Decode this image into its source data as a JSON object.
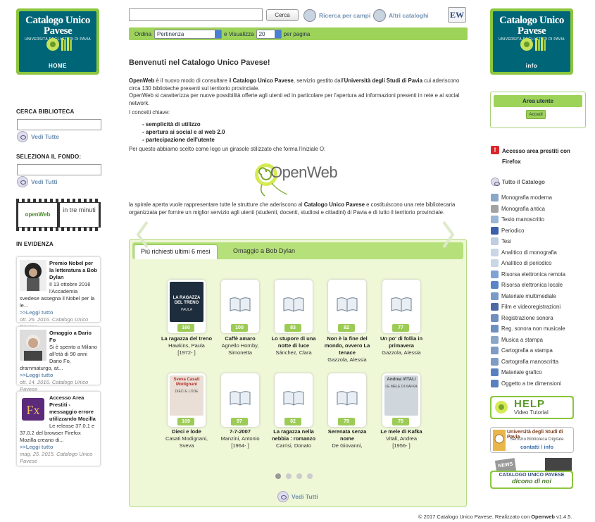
{
  "logos": {
    "left": {
      "title": "Catalogo Unico Pavese",
      "subtitle": "UNIVERSITÀ DEGLI STUDI DI PAVIA",
      "label": "HOME"
    },
    "right": {
      "title": "Catalogo Unico Pavese",
      "subtitle": "UNIVERSITÀ DEGLI STUDI DI PAVIA",
      "label": "info"
    }
  },
  "header": {
    "search_value": "",
    "search_button": "Cerca",
    "advanced_search": "Ricerca per campi",
    "other_catalogs": "Altri cataloghi",
    "ew_badge": "EW",
    "order_label": "Ordina",
    "order_value": "Pertinenza",
    "view_label": "e Visualizza",
    "view_value": "20",
    "per_page": "per pagina"
  },
  "left": {
    "cerca_biblioteca": "CERCA BIBLIOTECA",
    "vedi_tutte": "Vedi Tutte",
    "seleziona_fondo": "SELEZIONA IL FONDO:",
    "vedi_tutti": "Vedi Tutti",
    "video": {
      "brand": "openWeb",
      "caption": "in tre minuti"
    },
    "in_evidenza": "IN EVIDENZA",
    "news": [
      {
        "title": "Premio Nobel per la letteratura a Bob Dylan",
        "body": "Il 13 ottobre 2016 l'Accademia svedese assegna il Nobel per la le...",
        "more": ">>Leggi tutto",
        "date": "ott. 26. 2016.",
        "source": "Catalogo Unico Pavese"
      },
      {
        "title": "Omaggio a Dario Fo",
        "body": "Si è spento a Milano all'età di 90 anni Dario Fo, drammaturgo, at...",
        "more": ">>Leggi tutto",
        "date": "ott. 14. 2016.",
        "source": "Catalogo Unico Pavese"
      },
      {
        "title": "Accesso Area Prestiti - messaggio errore utilizzando Mozilla",
        "body": "Le release 37.0.1 e 37.0.2 del browser Firefox Mozilla creano di...",
        "more": ">>Leggi tutto",
        "date": "mag. 25. 2015.",
        "source": "Catalogo Unico Pavese"
      }
    ]
  },
  "main": {
    "welcome": "Benvenuti nel Catalogo Unico Pavese!",
    "intro_1": "OpenWeb",
    "intro_2": " è il nuovo modo di consultare  il ",
    "intro_3": "Catalogo Unico Pavese",
    "intro_4": ", servizio gestito dall'",
    "intro_5": "Università degli Studi di Pavia",
    "intro_6": " cui aderiscono circa 130 biblioteche presenti sul territorio provinciale.",
    "intro_7": "OpenWeb si caratterizza per nuove possibilità offerte agli utenti ed in particolare per l'apertura ad informazioni presenti in rete e ai social network.",
    "concepts": "I concetti chiave:",
    "keys": [
      "- semplicità di utilizzo",
      "- apertura ai social e al web 2.0",
      "- partecipazione dell'utente"
    ],
    "logo_text": "Per questo abbiamo scelto come logo un girasole stilizzato che forma l'iniziale O:",
    "openweb_logo": "OpenWeb",
    "spiral_1": "la spirale aperta vuole rappresentare tutte le strutture che aderiscono al ",
    "spiral_2": "Catalogo Unico Pavese",
    "spiral_3": " e costituiscono una rete bibliotecaria organizzata per fornire un miglior servizio agli utenti (studenti, docenti, studiosi e cittadini) di Pavia e di tutto il territorio provinciale."
  },
  "carousel": {
    "tabs": [
      "Più richiesti ultimi 6 mesi",
      "Omaggio a Bob Dylan"
    ],
    "see_all": "Vedi Tutti",
    "books": [
      {
        "count": "160",
        "title": "La ragazza del treno",
        "author": "Hawkins, Paula",
        "extra": "[1972- ]",
        "cover": "treno",
        "cover_title": "LA RAGAZZA DEL TRENO",
        "cover_author": "PAULA"
      },
      {
        "count": "100",
        "title": "Caffè amaro",
        "author": "Agnello Hornby, Simonetta",
        "extra": "",
        "cover": ""
      },
      {
        "count": "83",
        "title": "Lo stupore di una notte di luce",
        "author": "Sánchez, Clara",
        "extra": "",
        "cover": ""
      },
      {
        "count": "82",
        "title": "Non è la fine del mondo, ovvero La tenace",
        "author": "Gazzola, Alessia",
        "extra": "",
        "cover": ""
      },
      {
        "count": "77",
        "title": "Un po' di follia in primavera",
        "author": "Gazzola, Alessia",
        "extra": "",
        "cover": ""
      },
      {
        "count": "109",
        "title": "Dieci e lode",
        "author": "Casati Modignani, Sveva",
        "extra": "",
        "cover": "dieci",
        "cover_title": "Sveva Casati Modignani",
        "cover_author": "DIECI E LODE"
      },
      {
        "count": "97",
        "title": "7-7-2007",
        "author": "Manzini, Antonio",
        "extra": "[1964- ]",
        "cover": ""
      },
      {
        "count": "82",
        "title": "La ragazza nella nebbia : romanzo",
        "author": "Carrisi, Donato",
        "extra": "",
        "cover": ""
      },
      {
        "count": "79",
        "title": "Serenata senza nome",
        "author": "De Giovanni,",
        "extra": "",
        "cover": ""
      },
      {
        "count": "75",
        "title": "Le mele di Kafka",
        "author": "Vitali, Andrea",
        "extra": "[1956- ]",
        "cover": "kafka",
        "cover_title": "Andrea VITALI",
        "cover_author": "LE MELE DI KAFKA"
      }
    ]
  },
  "right": {
    "area_utente": "Area utente",
    "accedi": "Accedi",
    "prestiti": "Accesso area prestiti con Firefox",
    "tutto": "Tutto il Catalogo",
    "items": [
      {
        "label": "Monografia moderna",
        "color": "#8aa6c8"
      },
      {
        "label": "Monografia antica",
        "color": "#a3a3a3"
      },
      {
        "label": "Testo manoscritto",
        "color": "#9bb5d5"
      },
      {
        "label": "Periodico",
        "color": "#3b5fa8"
      },
      {
        "label": "Tesi",
        "color": "#bfcde0"
      },
      {
        "label": "Analitico di monografia",
        "color": "#c9d6e6"
      },
      {
        "label": "Analitico di periodico",
        "color": "#c9d6e6"
      },
      {
        "label": "Risorsa elettronica remota",
        "color": "#7fa4d4"
      },
      {
        "label": "Risorsa elettronica locale",
        "color": "#5a85c8"
      },
      {
        "label": "Materiale multimediale",
        "color": "#7a9ac8"
      },
      {
        "label": "Film e videoregistrazioni",
        "color": "#4b6aa6"
      },
      {
        "label": "Registrazione sonora",
        "color": "#6f8fbf"
      },
      {
        "label": "Reg. sonora non musicale",
        "color": "#6f8fbf"
      },
      {
        "label": "Musica a stampa",
        "color": "#8aa6c8"
      },
      {
        "label": "Cartografia a stampa",
        "color": "#7e9cc4"
      },
      {
        "label": "Cartografia manoscritta",
        "color": "#7e9cc4"
      },
      {
        "label": "Materiale grafico",
        "color": "#5a7fbf"
      },
      {
        "label": "Oggetto a tre dimensioni",
        "color": "#5a7fbf"
      }
    ],
    "help": {
      "title": "HELP",
      "subtitle": "Video Tutorial"
    },
    "unipv": {
      "line1": "Università degli Studi di Pavia",
      "line2": "Servizio Biblioteca Digitale",
      "line3": "contatti / info"
    },
    "news_box": {
      "badge": "NEWS",
      "line1": "CATALOGO UNICO PAVESE",
      "line2": "dicono di noi"
    }
  },
  "footer": {
    "text": "© 2017 Catalogo Unico Pavese. Realizzato con ",
    "brand": "Openweb",
    "version": " v1.4.5."
  }
}
